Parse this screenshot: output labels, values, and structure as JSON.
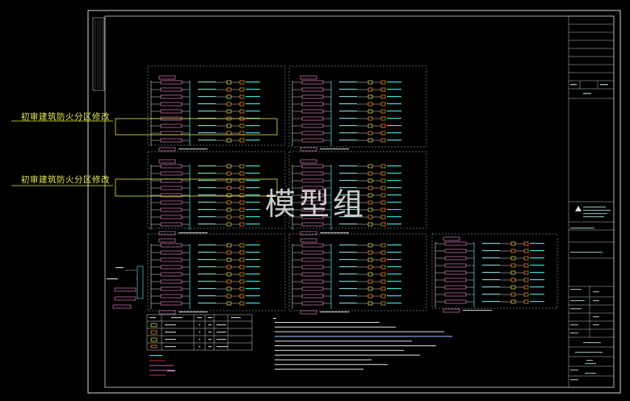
{
  "annotations": {
    "note_1": "初审建筑防火分区修改",
    "note_2": "初审建筑防火分区修改"
  },
  "watermark": "模型组",
  "colors": {
    "background": "#000000",
    "frame": "#d8d8d8",
    "cyan": "#3fd6d6",
    "pink": "#ff8ad8",
    "yellow": "#e6e64a",
    "orange": "#ff9a2a",
    "dashed_border": "#9ec3c3",
    "annotation": "#e6e64a"
  }
}
